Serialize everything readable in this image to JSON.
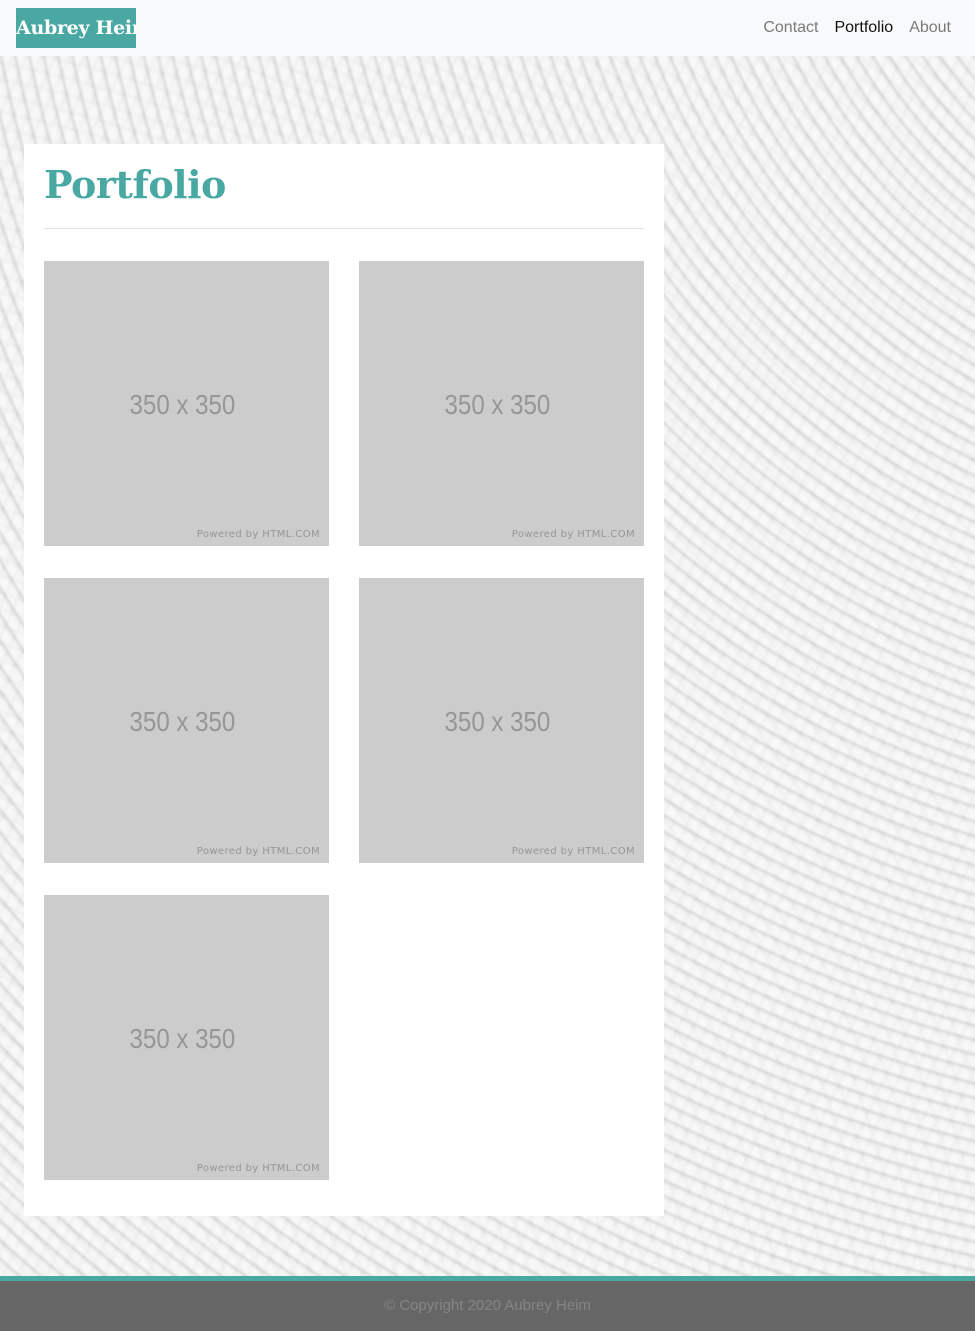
{
  "navbar": {
    "brand": "Aubrey Heim",
    "links": [
      {
        "label": "Contact",
        "active": false
      },
      {
        "label": "Portfolio",
        "active": true
      },
      {
        "label": "About",
        "active": false
      }
    ]
  },
  "main": {
    "title": "Portfolio",
    "thumbnails": [
      {
        "size_text": "350 x 350",
        "powered_text": "Powered by HTML.COM"
      },
      {
        "size_text": "350 x 350",
        "powered_text": "Powered by HTML.COM"
      },
      {
        "size_text": "350 x 350",
        "powered_text": "Powered by HTML.COM"
      },
      {
        "size_text": "350 x 350",
        "powered_text": "Powered by HTML.COM"
      },
      {
        "size_text": "350 x 350",
        "powered_text": "Powered by HTML.COM"
      }
    ]
  },
  "footer": {
    "copyright": "© Copyright 2020 Aubrey Heim"
  },
  "colors": {
    "accent": "#4aa8a2",
    "placeholder": "#cccccc",
    "footer_bg": "#666666",
    "navbar_bg": "#f8f9fa"
  }
}
